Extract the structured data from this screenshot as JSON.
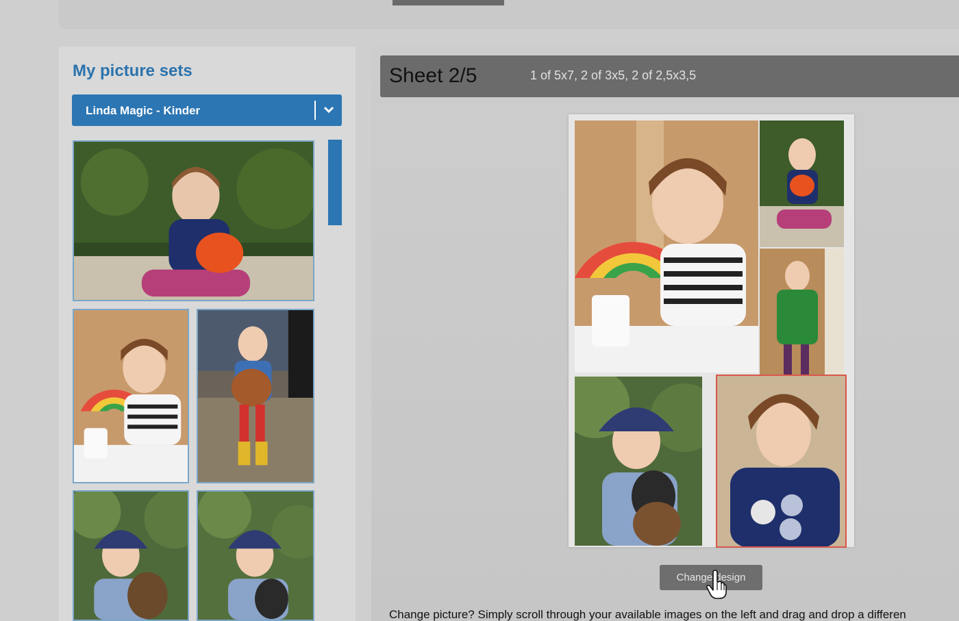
{
  "left_panel": {
    "title": "My picture sets",
    "selected_set": "Linda Magic - Kinder"
  },
  "sheet": {
    "title": "Sheet 2/5",
    "sizes": "1 of 5x7, 2 of 3x5, 2 of 2,5x3,5"
  },
  "actions": {
    "change_design": "Change design"
  },
  "help": {
    "text": "Change picture? Simply scroll through your available images on the left and drag and drop a differen"
  },
  "colors": {
    "accent": "#2c76b3",
    "selected_outline": "#d9574a"
  }
}
